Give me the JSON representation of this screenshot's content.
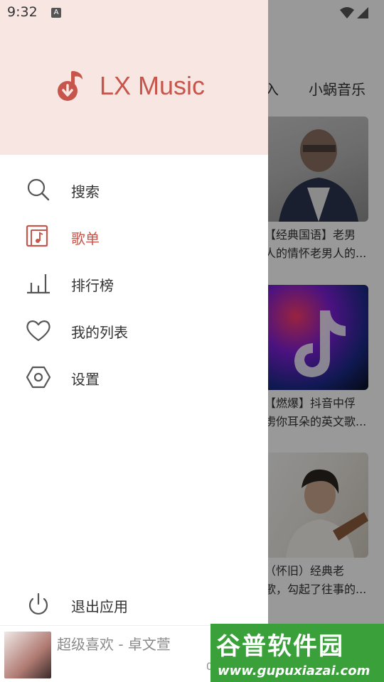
{
  "status_bar": {
    "time": "9:32",
    "notification_icon": "A"
  },
  "background": {
    "tabs": [
      "入",
      "小蜗音乐"
    ],
    "cards": [
      {
        "line1": "【经典国语】老男",
        "line2": "人的情怀老男人的..."
      },
      {
        "line1": "【燃爆】抖音中俘",
        "line2": "虏你耳朵的英文歌..."
      },
      {
        "line1": "（怀旧）经典老",
        "line2": "歌，勾起了往事的..."
      }
    ]
  },
  "drawer": {
    "app_name": "LX Music",
    "menu": [
      {
        "label": "搜索",
        "icon": "search-icon"
      },
      {
        "label": "歌单",
        "icon": "playlist-icon",
        "active": true
      },
      {
        "label": "排行榜",
        "icon": "chart-icon"
      },
      {
        "label": "我的列表",
        "icon": "heart-icon"
      },
      {
        "label": "设置",
        "icon": "settings-icon"
      }
    ],
    "exit_label": "退出应用"
  },
  "player": {
    "title": "超级喜欢 - 卓文萱",
    "time": "0"
  },
  "watermark": {
    "title": "谷普软件园",
    "url": "www.gupuxiazai.com"
  },
  "colors": {
    "accent": "#c6564b",
    "header_bg": "#f8e6e3"
  }
}
